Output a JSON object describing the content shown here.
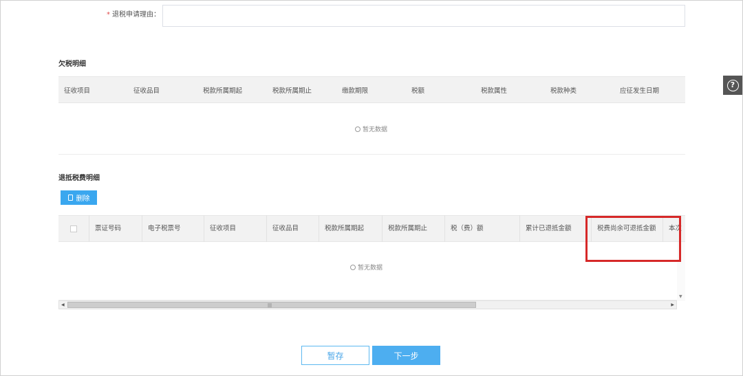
{
  "form": {
    "reason_required_mark": "*",
    "reason_label": "退税申请理由：",
    "reason_value": ""
  },
  "arrears_section": {
    "title": "欠税明细",
    "columns": [
      "征收项目",
      "征收品目",
      "税款所属期起",
      "税款所属期止",
      "缴款期限",
      "税额",
      "税款属性",
      "税款种类",
      "应征发生日期"
    ],
    "empty_text": "暂无数据"
  },
  "refund_section": {
    "title": "退抵税费明细",
    "delete_label": "删除",
    "columns": [
      "票证号码",
      "电子税票号",
      "征收项目",
      "征收品目",
      "税款所属期起",
      "税款所属期止",
      "税（费）额",
      "累计已退抵金额",
      "税费尚余可退抵金额",
      "本次"
    ],
    "empty_text": "暂无数据",
    "scroll_grip": "|||"
  },
  "actions": {
    "save_label": "暂存",
    "next_label": "下一步"
  },
  "help": {
    "icon": "question-circle-icon",
    "glyph": "?"
  },
  "colors": {
    "primary": "#4daef0",
    "highlight": "#d62828",
    "required": "#e14b4b"
  }
}
